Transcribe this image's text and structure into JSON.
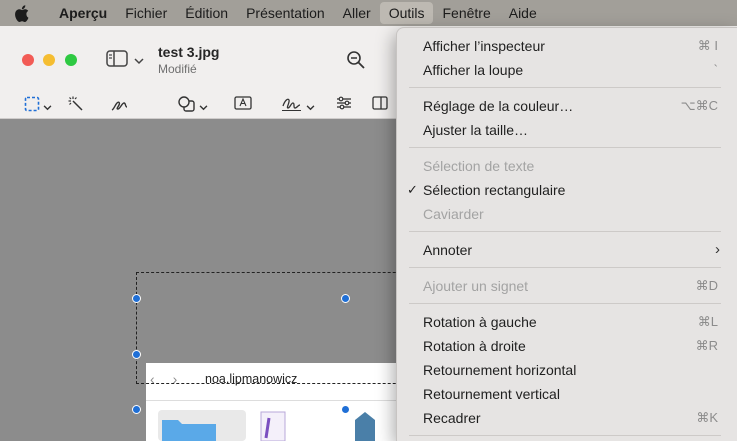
{
  "menubar": {
    "app_name": "Aperçu",
    "items": [
      "Fichier",
      "Édition",
      "Présentation",
      "Aller",
      "Outils",
      "Fenêtre",
      "Aide"
    ],
    "active_item": "Outils"
  },
  "window": {
    "title": "test 3.jpg",
    "subtitle": "Modifié"
  },
  "image": {
    "username": "noa.lipmanowicz"
  },
  "tools_menu": {
    "items": [
      {
        "label": "Afficher l’inspecteur",
        "shortcut": "⌘ I",
        "enabled": true
      },
      {
        "label": "Afficher la loupe",
        "shortcut": "`",
        "enabled": true
      },
      {
        "label": "Réglage de la couleur…",
        "shortcut": "⌥⌘C",
        "enabled": true
      },
      {
        "label": "Ajuster la taille…",
        "shortcut": "",
        "enabled": true
      },
      {
        "label": "Sélection de texte",
        "shortcut": "",
        "enabled": false
      },
      {
        "label": "Sélection rectangulaire",
        "shortcut": "",
        "enabled": true,
        "checked": true
      },
      {
        "label": "Caviarder",
        "shortcut": "",
        "enabled": false
      },
      {
        "label": "Annoter",
        "shortcut": "",
        "enabled": true,
        "submenu": true
      },
      {
        "label": "Ajouter un signet",
        "shortcut": "⌘D",
        "enabled": false
      },
      {
        "label": "Rotation à gauche",
        "shortcut": "⌘L",
        "enabled": true
      },
      {
        "label": "Rotation à droite",
        "shortcut": "⌘R",
        "enabled": true
      },
      {
        "label": "Retournement horizontal",
        "shortcut": "",
        "enabled": true
      },
      {
        "label": "Retournement vertical",
        "shortcut": "",
        "enabled": true
      },
      {
        "label": "Recadrer",
        "shortcut": "⌘K",
        "enabled": true
      }
    ],
    "checkmark": "✓",
    "submenu_arrow": "›"
  },
  "icons": {
    "apple": "apple-icon",
    "sidebar": "sidebar-toggle-icon",
    "zoom": "zoom-out-icon",
    "toolbar": [
      "rectangular-selection-icon",
      "instant-alpha-icon",
      "sketch-icon",
      "shapes-icon",
      "text-box-icon",
      "signature-icon",
      "adjust-color-icon",
      "page-layout-icon"
    ]
  },
  "colors": {
    "menubar_bg": "#a29f99",
    "selection_handle": "#1f6fd6",
    "traffic_red": "#f25b55",
    "traffic_yellow": "#f5bd31",
    "traffic_green": "#2ec942"
  }
}
